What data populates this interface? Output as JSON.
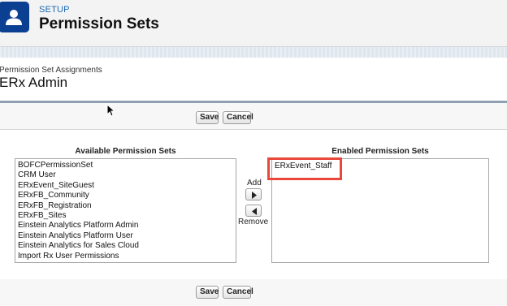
{
  "header": {
    "setup_label": "SETUP",
    "page_title": "Permission Sets",
    "icon": "user-icon"
  },
  "assignment": {
    "subtitle": "Permission Set Assignments",
    "title": "ERx Admin"
  },
  "buttons": {
    "save": "Save",
    "cancel": "Cancel"
  },
  "available": {
    "title": "Available Permission Sets",
    "items": [
      "BOFCPermissionSet",
      "CRM User",
      "ERxEvent_SiteGuest",
      "ERxFB_Community",
      "ERxFB_Registration",
      "ERxFB_Sites",
      "Einstein Analytics Platform Admin",
      "Einstein Analytics Platform User",
      "Einstein Analytics for Sales Cloud",
      "Import Rx User Permissions"
    ]
  },
  "enabled": {
    "title": "Enabled Permission Sets",
    "items": [
      "ERxEvent_Staff"
    ]
  },
  "move": {
    "add_label": "Add",
    "remove_label": "Remove",
    "add_icon": "arrow-right-icon",
    "remove_icon": "arrow-left-icon"
  },
  "colors": {
    "header_icon_bg": "#0a3f91",
    "setup_link": "#1a6ab8",
    "highlight": "#e8473a"
  }
}
